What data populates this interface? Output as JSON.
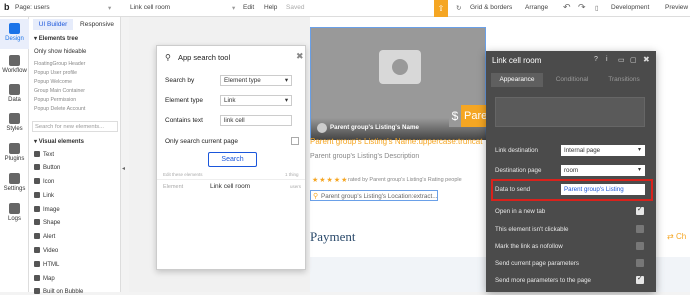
{
  "topbar": {
    "page_label": "Page: users",
    "element_name": "Link cell room",
    "menu_edit": "Edit",
    "menu_help": "Help",
    "status_saved": "Saved",
    "grid_borders": "Grid & borders",
    "arrange": "Arrange",
    "version": "Development",
    "preview": "Preview"
  },
  "rail": {
    "items": [
      {
        "label": "Design",
        "icon": "design-icon"
      },
      {
        "label": "Workflow",
        "icon": "workflow-icon"
      },
      {
        "label": "Data",
        "icon": "data-icon"
      },
      {
        "label": "Styles",
        "icon": "styles-icon"
      },
      {
        "label": "Plugins",
        "icon": "plugins-icon"
      },
      {
        "label": "Settings",
        "icon": "gear-icon"
      },
      {
        "label": "Logs",
        "icon": "logs-icon"
      }
    ]
  },
  "panel": {
    "tab_ui_builder": "UI Builder",
    "tab_responsive": "Responsive",
    "elements_tree": "Elements tree",
    "only_hideable": "Only show hideable",
    "tree_items": [
      "FloatingGroup Header",
      "Popup User profile",
      "Popup Welcome",
      "Group Main Container",
      "Popup Permission",
      "Popup Delete Account"
    ],
    "search_placeholder": "Search for new elements...",
    "visual_elements": "Visual elements",
    "visual_items": [
      "Text",
      "Button",
      "Icon",
      "Link",
      "Image",
      "Shape",
      "Alert",
      "Video",
      "HTML",
      "Map",
      "Built on Bubble"
    ]
  },
  "dialog": {
    "title": "App search tool",
    "search_by_label": "Search by",
    "search_by_value": "Element type",
    "element_type_label": "Element type",
    "element_type_value": "Link",
    "contains_label": "Contains text",
    "contains_value": "link cell",
    "current_page_label": "Only search current page",
    "search_button": "Search",
    "edit_hint": "Edit these elements",
    "count": "1 thing",
    "result_type": "Element",
    "result_name": "Link cell room",
    "result_page": "users"
  },
  "canvas": {
    "listing_name": "Parent group's Listing's Name:uppercase:truncat",
    "listing_desc": "Parent group's Listing's Description",
    "rated_text": "rated by Parent group's Listing's Rating people",
    "location": "Parent group's Listing's Location:extract...",
    "banner_label": "Parent group's Listing's Name",
    "price_symbol": "$",
    "price_label": "Pare",
    "payment": "Payment",
    "right_cut": "Ch"
  },
  "props": {
    "title": "Link cell room",
    "tab_appearance": "Appearance",
    "tab_conditional": "Conditional",
    "tab_transitions": "Transitions",
    "link_destination_label": "Link destination",
    "link_destination_value": "Internal page",
    "destination_page_label": "Destination page",
    "destination_page_value": "room",
    "data_to_send_label": "Data to send",
    "data_to_send_value": "Parent group's Listing",
    "open_new_tab": "Open in a new tab",
    "not_clickable": "This element isn't clickable",
    "nofollow": "Mark the link as nofollow",
    "send_params": "Send current page parameters",
    "send_more_params": "Send more parameters to the page"
  },
  "colors": {
    "accent": "#1a73e8",
    "orange": "#f5a623",
    "highlight_red": "#d9221c",
    "panel_dark": "#4b4b4b"
  }
}
